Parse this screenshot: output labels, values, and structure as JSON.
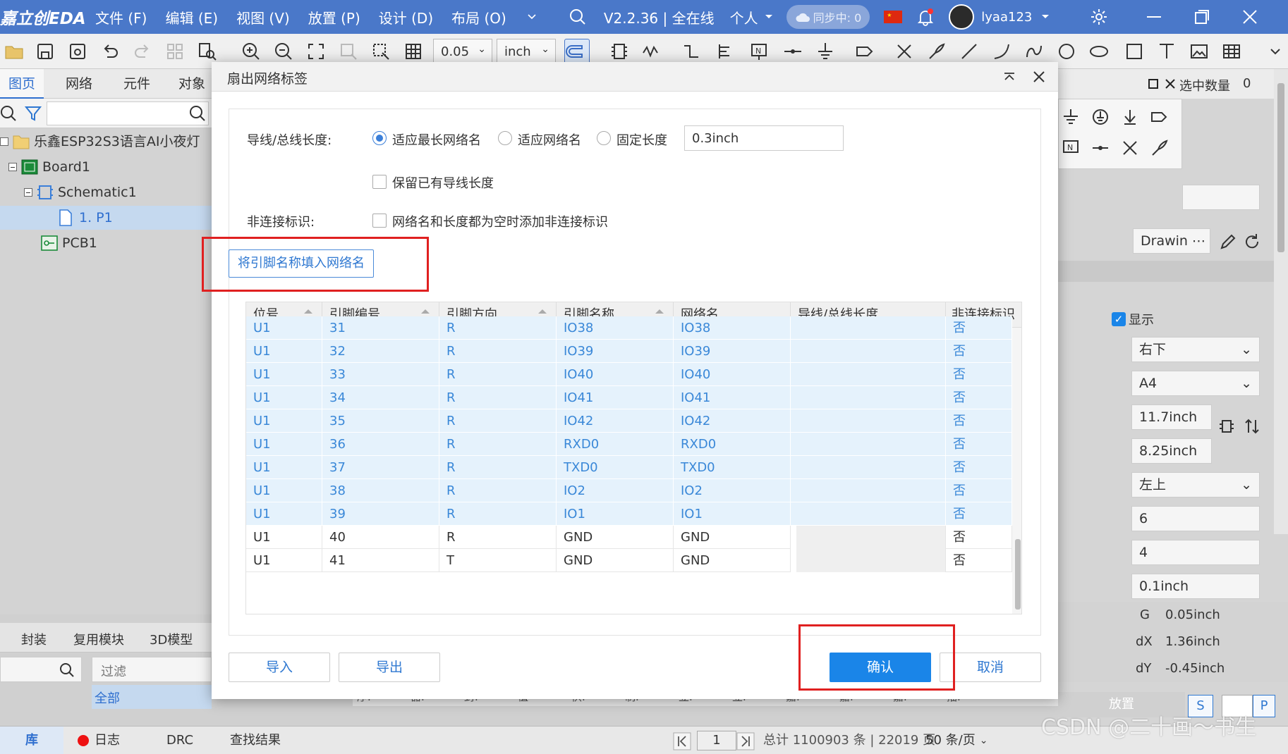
{
  "menubar": {
    "logo": "嘉立创EDA",
    "items": [
      "文件 (F)",
      "编辑 (E)",
      "视图 (V)",
      "放置 (P)",
      "设计 (D)",
      "布局 (O)"
    ],
    "version": "V2.2.36 | 全在线",
    "personal": "个人",
    "sync": "同步中: 0",
    "user": "lyaa123"
  },
  "toolbar": {
    "grid": "0.05",
    "unit": "inch"
  },
  "left": {
    "tabs": [
      "图页",
      "网络",
      "元件",
      "对象"
    ],
    "tree": {
      "project": "乐鑫ESP32S3语言AI小夜灯",
      "board": "Board1",
      "schematic": "Schematic1",
      "page": "1. P1",
      "pcb": "PCB1"
    }
  },
  "bottom": {
    "tabs": [
      "封装",
      "复用模块",
      "3D模型"
    ],
    "filter_placeholder": "过滤",
    "all": "全部",
    "cols": [
      "序.",
      "器.",
      "封.",
      "值",
      "供.",
      "制.",
      "立.",
      "立.",
      "嘉.",
      "嘉.",
      "嘉.",
      "描."
    ]
  },
  "right": {
    "title": "选中数量",
    "count": "0",
    "drawing": "Drawin",
    "show": "显示",
    "pos1": "右下",
    "paper": "A4",
    "w": "11.7inch",
    "h": "8.25inch",
    "pos2": "左上",
    "n1": "6",
    "n2": "4",
    "grid": "0.1inch",
    "g_label": "G",
    "g_val": "0.05inch",
    "dx_label": "dX",
    "dx_val": "1.36inch",
    "dy_label": "dY",
    "dy_val": "-0.45inch",
    "place": "放置",
    "s": "S",
    "p": "P"
  },
  "status": {
    "library": "库",
    "log": "日志",
    "drc": "DRC",
    "find": "查找结果",
    "page": "1",
    "total": "总计 1100903 条 | 22019 页",
    "per_page": "50 条/页"
  },
  "watermark": "CSDN @二十画～书生",
  "dialog": {
    "title": "扇出网络标签",
    "wire_label": "导线/总线长度:",
    "opt1": "适应最长网络名",
    "opt2": "适应网络名",
    "opt3": "固定长度",
    "fixed_value": "0.3inch",
    "keep": "保留已有导线长度",
    "nc_label": "非连接标识:",
    "nc_opt": "网络名和长度都为空时添加非连接标识",
    "fill_btn": "将引脚名称填入网络名",
    "columns": [
      "位号",
      "引脚编号",
      "引脚方向",
      "引脚名称",
      "网络名",
      "导线/总线长度",
      "非连接标识"
    ],
    "rows": [
      {
        "ref": "U1",
        "num": "31",
        "dir": "R",
        "pin": "IO38",
        "net": "IO38",
        "len": "",
        "nc": "否",
        "sel": true
      },
      {
        "ref": "U1",
        "num": "32",
        "dir": "R",
        "pin": "IO39",
        "net": "IO39",
        "len": "",
        "nc": "否",
        "sel": true
      },
      {
        "ref": "U1",
        "num": "33",
        "dir": "R",
        "pin": "IO40",
        "net": "IO40",
        "len": "",
        "nc": "否",
        "sel": true
      },
      {
        "ref": "U1",
        "num": "34",
        "dir": "R",
        "pin": "IO41",
        "net": "IO41",
        "len": "",
        "nc": "否",
        "sel": true
      },
      {
        "ref": "U1",
        "num": "35",
        "dir": "R",
        "pin": "IO42",
        "net": "IO42",
        "len": "",
        "nc": "否",
        "sel": true
      },
      {
        "ref": "U1",
        "num": "36",
        "dir": "R",
        "pin": "RXD0",
        "net": "RXD0",
        "len": "",
        "nc": "否",
        "sel": true
      },
      {
        "ref": "U1",
        "num": "37",
        "dir": "R",
        "pin": "TXD0",
        "net": "TXD0",
        "len": "",
        "nc": "否",
        "sel": true
      },
      {
        "ref": "U1",
        "num": "38",
        "dir": "R",
        "pin": "IO2",
        "net": "IO2",
        "len": "",
        "nc": "否",
        "sel": true
      },
      {
        "ref": "U1",
        "num": "39",
        "dir": "R",
        "pin": "IO1",
        "net": "IO1",
        "len": "",
        "nc": "否",
        "sel": true
      },
      {
        "ref": "U1",
        "num": "40",
        "dir": "R",
        "pin": "GND",
        "net": "GND",
        "len": "",
        "nc": "否",
        "sel": false
      },
      {
        "ref": "U1",
        "num": "41",
        "dir": "T",
        "pin": "GND",
        "net": "GND",
        "len": "",
        "nc": "否",
        "sel": false
      }
    ],
    "import": "导入",
    "export": "导出",
    "ok": "确认",
    "cancel": "取消"
  },
  "colors": {
    "accent": "#4a78c9",
    "primary": "#1a85e8",
    "selected_row": "#e5f2fc",
    "highlight": "#e02020"
  }
}
